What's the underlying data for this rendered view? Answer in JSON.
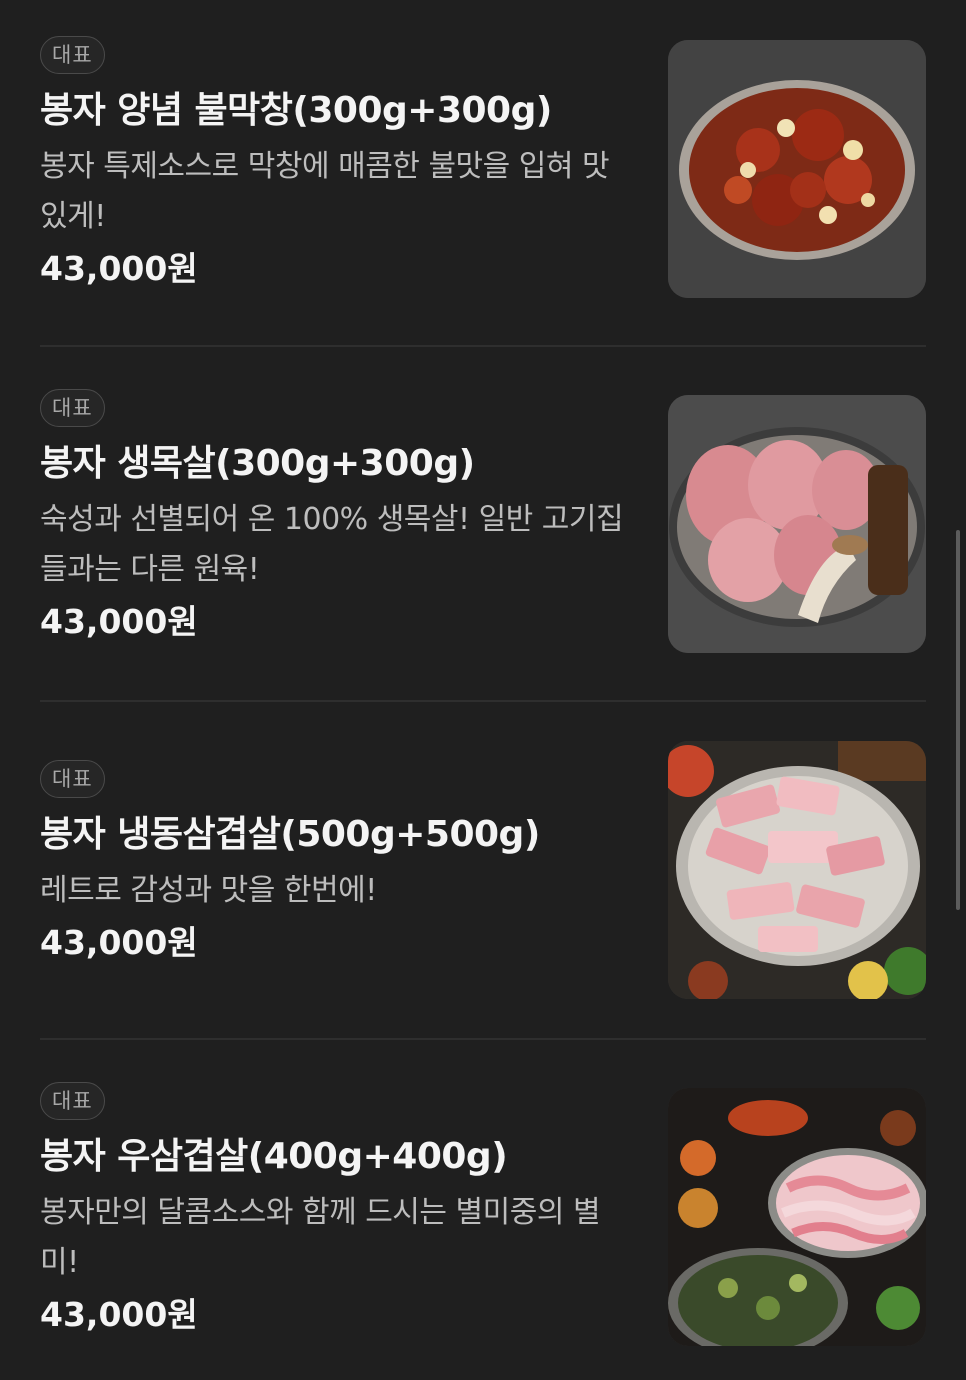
{
  "menu": {
    "items": [
      {
        "badge": "대표",
        "name": "봉자 양념 불막창(300g+300g)",
        "description": "봉자 특제소스로 막창에 매콤한 불맛을 입혀 맛있게!",
        "price": "43,000원",
        "image_icon": "spicy-grilled-makchang-photo"
      },
      {
        "badge": "대표",
        "name": "봉자 생목살(300g+300g)",
        "description": "숙성과 선별되어 온 100% 생목살! 일반 고기집들과는 다른 원육!",
        "price": "43,000원",
        "image_icon": "pork-neck-photo"
      },
      {
        "badge": "대표",
        "name": "봉자 냉동삼겹살(500g+500g)",
        "description": "레트로 감성과 맛을 한번에!",
        "price": "43,000원",
        "image_icon": "frozen-pork-belly-photo"
      },
      {
        "badge": "대표",
        "name": "봉자 우삼겹살(400g+400g)",
        "description": "봉자만의 달콤소스와 함께 드시는 별미중의 별미!",
        "price": "43,000원",
        "image_icon": "beef-brisket-spread-photo"
      }
    ]
  },
  "colors": {
    "background": "#1f1f1f",
    "title": "#f4f4f4",
    "description": "#bdbdbd",
    "badge_text": "#a8a8a8",
    "divider": "#2e2e2e"
  }
}
